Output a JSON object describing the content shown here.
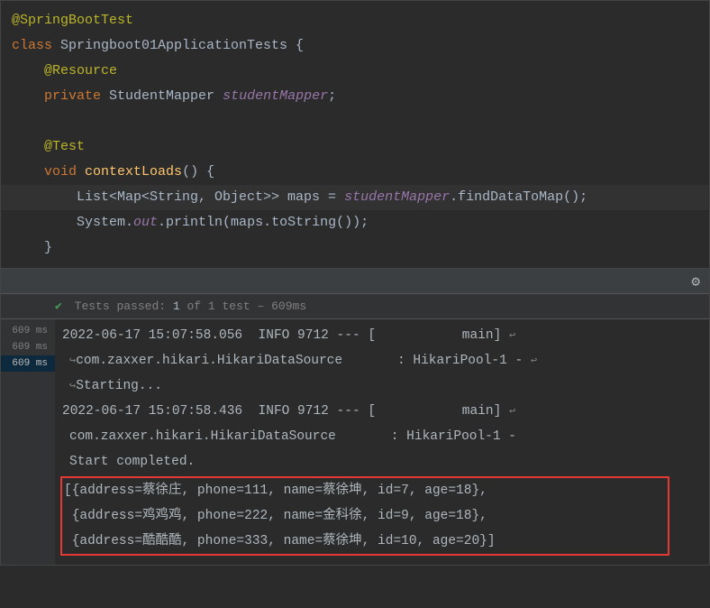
{
  "code": {
    "line1_anno": "@SpringBootTest",
    "line2_kw": "class",
    "line2_name": " Springboot01ApplicationTests {",
    "line3_anno": "@Resource",
    "line4_kw": "private",
    "line4_type": " StudentMapper ",
    "line4_field": "studentMapper",
    "line4_end": ";",
    "line6_anno": "@Test",
    "line7_kw": "void",
    "line7_method": " contextLoads",
    "line7_rest": "() {",
    "line8_pre": "List<Map<String, Object>> maps = ",
    "line8_field": "studentMapper",
    "line8_call": ".findDataToMap();",
    "line9_pre": "System.",
    "line9_out": "out",
    "line9_call": ".println(maps.toString());",
    "line10": "}"
  },
  "tests": {
    "prefix": "Tests passed:",
    "count": "1",
    "suffix": "of 1 test – 609ms"
  },
  "gutter": {
    "t1": "609 ms",
    "t2": "609 ms",
    "t3": "609 ms"
  },
  "console": {
    "l1": "2022-06-17 15:07:58.056  INFO 9712 --- [           main] ",
    "l2a": "com.zaxxer.hikari.HikariDataSource       : HikariPool-1 - ",
    "l2b": "Starting...",
    "l3": "2022-06-17 15:07:58.436  INFO 9712 --- [           main] ",
    "l4": "com.zaxxer.hikari.HikariDataSource       : HikariPool-1 - ",
    "l5": "Start completed.",
    "l6": "[{address=蔡徐庄, phone=111, name=蔡徐坤, id=7, age=18}, ",
    "l7": " {address=鸡鸡鸡, phone=222, name=金科徐, id=9, age=18}, ",
    "l8": " {address=酷酷酷, phone=333, name=蔡徐坤, id=10, age=20}]"
  }
}
